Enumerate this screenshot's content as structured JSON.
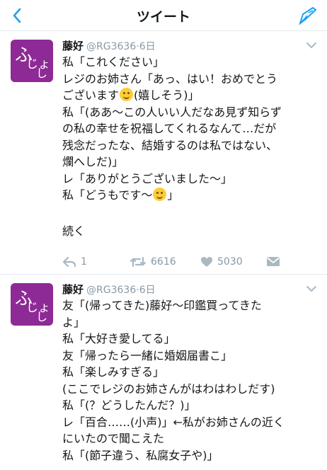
{
  "nav": {
    "title": "ツイート"
  },
  "tweets": [
    {
      "name": "藤好",
      "handle": "@RG3636",
      "time": "6日",
      "avatar_text": [
        "ふ",
        "じょ",
        "し"
      ],
      "lines": [
        "私「これください」",
        "レジのお姉さん「あっ、はい！おめでとう",
        "ございます",
        "(嬉しそう)」",
        "私「(ああ〜この人いい人だなあ見ず知らず",
        "の私の幸せを祝福してくれるなんて…だが",
        "残念だったな、結婚するのは私ではない、",
        "爛へしだ)」",
        "レ「ありがとうございました〜」",
        "私「どうもです〜",
        "」",
        "続く"
      ],
      "actions": {
        "reply": "1",
        "retweet": "6616",
        "like": "5030"
      }
    },
    {
      "name": "藤好",
      "handle": "@RG3636",
      "time": "6日",
      "avatar_text": [
        "ふ",
        "じょ",
        "し"
      ],
      "lines": [
        "友「(帰ってきた)藤好〜印鑑買ってきた",
        "よ」",
        "私「大好き愛してる」",
        "友「帰ったら一緒に婚姻届書こ」",
        "私「楽しみすぎる」",
        "(ここでレジのお姉さんがはわはわしだす)",
        "私「(？どうしたんだ？)」",
        "レ「百合……(小声)」←私がお姉さんの近く",
        "にいたので聞こえた",
        "私「(節子違う、私腐女子や)」"
      ]
    }
  ],
  "colors": {
    "accent": "#1da1f2",
    "avatar": "#8d2a95",
    "meta": "#8899a6",
    "text": "#14171a"
  },
  "icons": [
    "back-chevron-icon",
    "compose-icon",
    "caret-down-icon",
    "reply-icon",
    "retweet-icon",
    "like-heart-icon",
    "direct-message-icon"
  ]
}
